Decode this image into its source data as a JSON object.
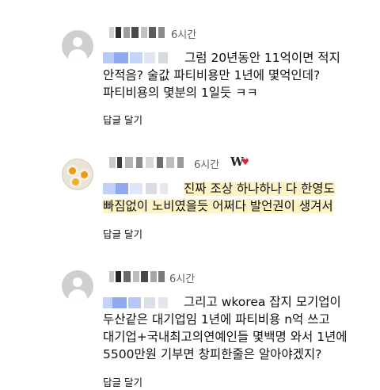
{
  "comments": [
    {
      "timestamp": "6시간",
      "lines": [
        "그럼 20년동안 11억이면 적지",
        "안적음? 술값 파티비용만 1년에 몇억인데?",
        "파티비용의 몇분의 1일듯 ㅋㅋ"
      ],
      "reply_label": "답글 달기"
    },
    {
      "timestamp": "6시간",
      "lines": [
        "진짜 조상 하나하나 다 한영도",
        "빠짐없이 노비였을듯 어쩌다 발언권이 생겨서"
      ],
      "reply_label": "답글 달기",
      "creator_heart": {
        "badge": "W",
        "heart": "♥"
      }
    },
    {
      "timestamp": "6시간",
      "lines": [
        "그리고 wkorea 잡지 모기업이",
        "두산같은 대기업임 1년에 파티비용 n억 쓰고",
        "대기업+국내최고의연예인들 몇백명 와서 1년에",
        "5500만원 기부면 창피한줄은 알아야겠지?"
      ],
      "reply_label": "답글 달기"
    }
  ],
  "colors": {
    "highlight": "#fdf3c7",
    "mention_blur": "#9ab3f5",
    "heart": "#e0243a",
    "meta_gray": "#606060"
  },
  "icons": {
    "default_avatar": "person-silhouette-icon",
    "egg_avatar": "fried-eggs-avatar"
  }
}
